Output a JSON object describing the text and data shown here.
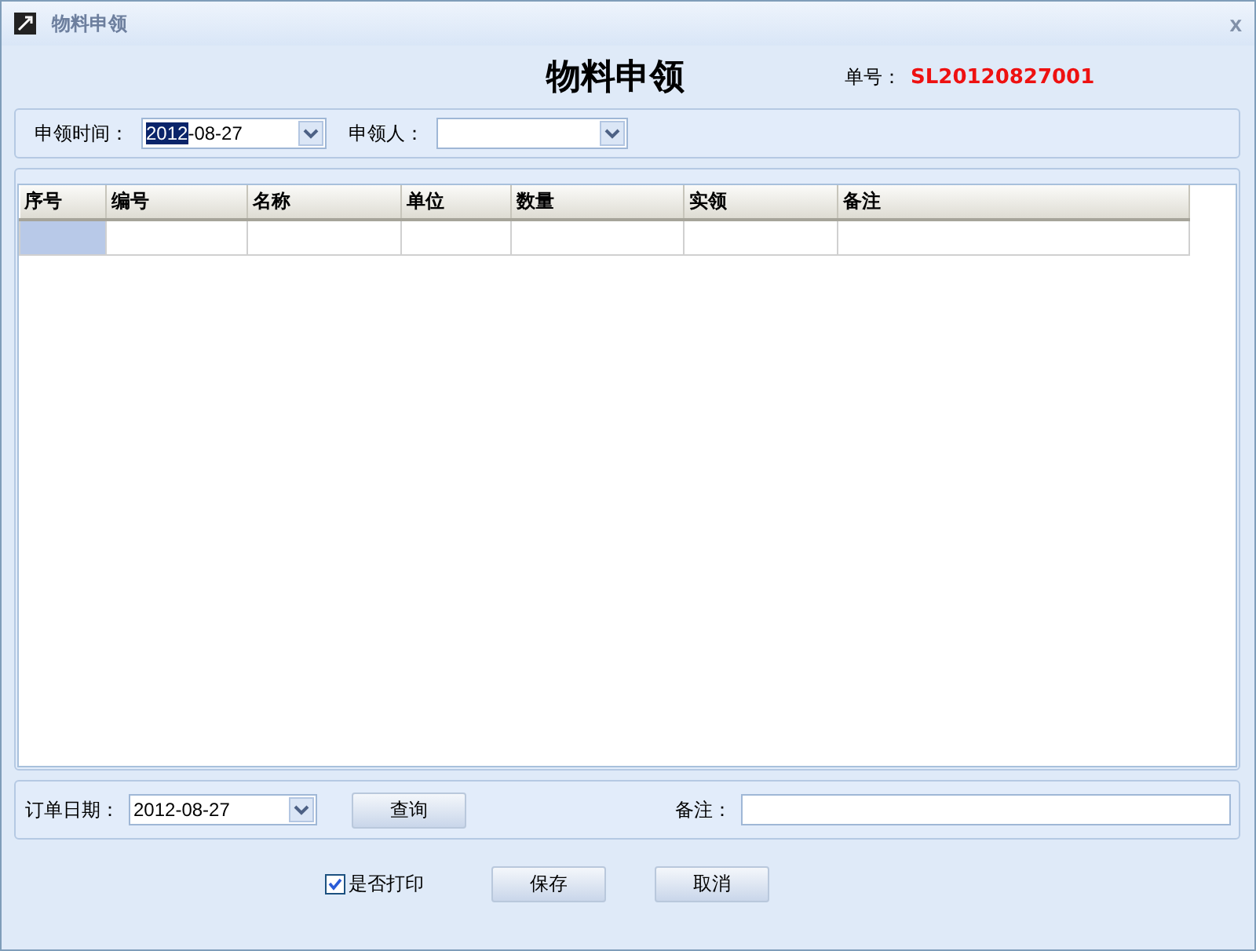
{
  "window": {
    "title": "物料申领",
    "close": "x"
  },
  "heading": "物料申领",
  "order_no": {
    "label": "单号：",
    "value": "SL20120827001"
  },
  "filter": {
    "time_label": "申领时间：",
    "time_selected": "2012",
    "time_rest": "-08-27",
    "person_label": "申领人："
  },
  "table": {
    "columns": [
      "序号",
      "编号",
      "名称",
      "单位",
      "数量",
      "实领",
      "备注"
    ],
    "rows": [
      {
        "first_cell_selected": true
      }
    ]
  },
  "query": {
    "date_label": "订单日期：",
    "date_value": "2012-08-27",
    "button": "查询",
    "note_label": "备注："
  },
  "print_checkbox": {
    "label": "是否打印",
    "checked": true
  },
  "buttons": [
    "保存",
    "取消"
  ]
}
